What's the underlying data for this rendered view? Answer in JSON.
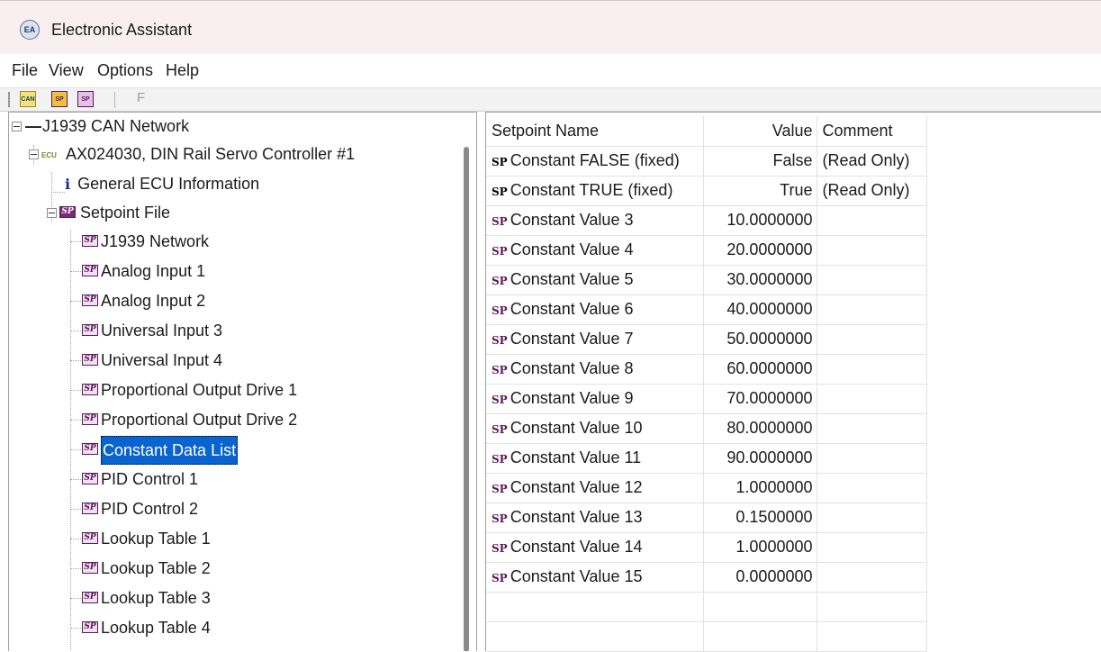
{
  "window": {
    "title": "Electronic Assistant",
    "icon": "electronic-assistant-app-icon"
  },
  "menu": [
    "File",
    "View",
    "Options",
    "Help"
  ],
  "toolbar": {
    "buttons": [
      {
        "name": "can-network-icon",
        "label": "CAN"
      },
      {
        "name": "open-setpoint-icon",
        "label": "SP"
      },
      {
        "name": "save-setpoint-icon",
        "label": "SP"
      }
    ],
    "f_label": "F"
  },
  "tree": {
    "root": "J1939 CAN Network",
    "ecu": "AX024030, DIN Rail Servo Controller #1",
    "ecu_tag": "ECU",
    "info": "General ECU Information",
    "setpoint_file": "Setpoint File",
    "items": [
      "J1939 Network",
      "Analog Input 1",
      "Analog Input 2",
      "Universal Input 3",
      "Universal Input 4",
      "Proportional Output Drive 1",
      "Proportional Output Drive 2",
      "Constant Data List",
      "PID Control 1",
      "PID Control 2",
      "Lookup Table 1",
      "Lookup Table 2",
      "Lookup Table 3",
      "Lookup Table 4"
    ],
    "selected": "Constant Data List",
    "sp_label": "SP"
  },
  "grid": {
    "headers": {
      "name": "Setpoint Name",
      "value": "Value",
      "comment": "Comment"
    },
    "rows": [
      {
        "name": "Constant FALSE (fixed)",
        "value": "False",
        "comment": "(Read Only)",
        "fixed": true
      },
      {
        "name": "Constant TRUE (fixed)",
        "value": "True",
        "comment": "(Read Only)",
        "fixed": true
      },
      {
        "name": "Constant Value 3",
        "value": "10.0000000",
        "comment": ""
      },
      {
        "name": "Constant Value 4",
        "value": "20.0000000",
        "comment": ""
      },
      {
        "name": "Constant Value 5",
        "value": "30.0000000",
        "comment": ""
      },
      {
        "name": "Constant Value 6",
        "value": "40.0000000",
        "comment": ""
      },
      {
        "name": "Constant Value 7",
        "value": "50.0000000",
        "comment": ""
      },
      {
        "name": "Constant Value 8",
        "value": "60.0000000",
        "comment": ""
      },
      {
        "name": "Constant Value 9",
        "value": "70.0000000",
        "comment": ""
      },
      {
        "name": "Constant Value 10",
        "value": "80.0000000",
        "comment": ""
      },
      {
        "name": "Constant Value 11",
        "value": "90.0000000",
        "comment": ""
      },
      {
        "name": "Constant Value 12",
        "value": "1.0000000",
        "comment": ""
      },
      {
        "name": "Constant Value 13",
        "value": "0.1500000",
        "comment": ""
      },
      {
        "name": "Constant Value 14",
        "value": "1.0000000",
        "comment": ""
      },
      {
        "name": "Constant Value 15",
        "value": "0.0000000",
        "comment": ""
      }
    ],
    "row_prefix": "SP"
  },
  "colors": {
    "selection": "#0a64d0",
    "title_bar": "#f9eff0",
    "setpoint_icon": "#5a1a5a"
  }
}
